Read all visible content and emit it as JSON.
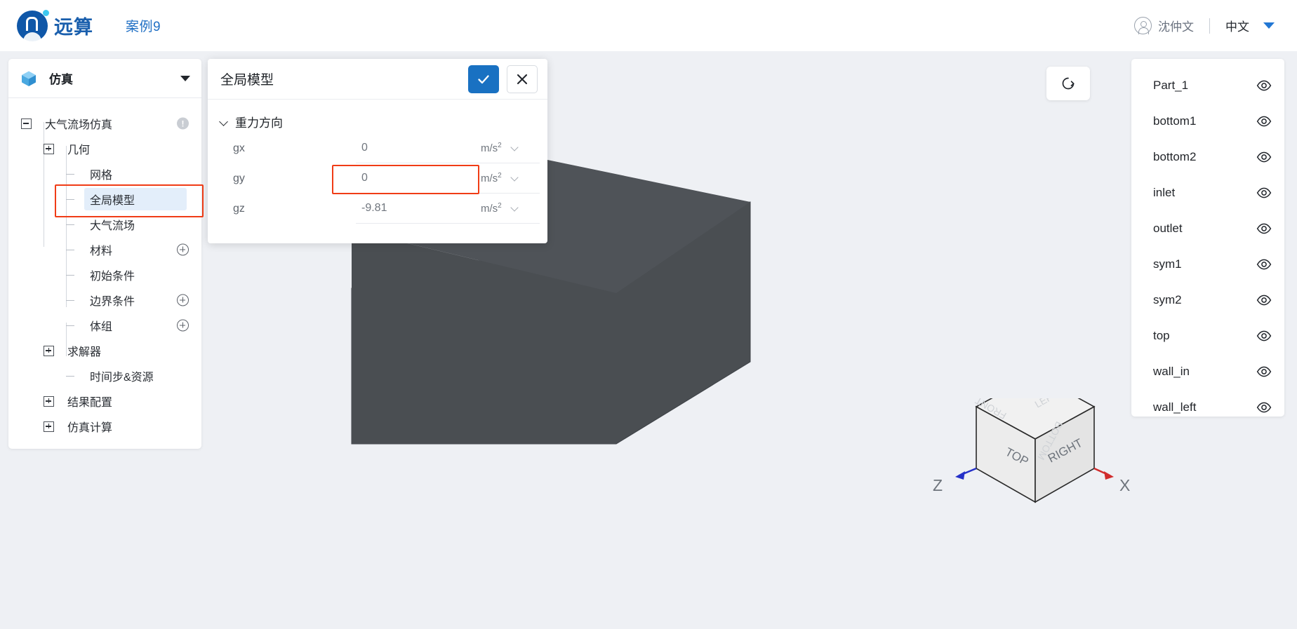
{
  "topbar": {
    "brand_name": "远算",
    "case_title": "案例9",
    "user_name": "沈仲文",
    "language": "中文"
  },
  "sidebar": {
    "header_title": "仿真",
    "tree": [
      {
        "label": "大气流场仿真",
        "toggle": "minus",
        "indent": 0,
        "badge": "!"
      },
      {
        "label": "几何",
        "toggle": "plus",
        "indent": 1
      },
      {
        "label": "网格",
        "toggle": "dash",
        "indent": 2
      },
      {
        "label": "全局模型",
        "toggle": "dash",
        "indent": 2,
        "selected": true
      },
      {
        "label": "大气流场",
        "toggle": "dash",
        "indent": 2
      },
      {
        "label": "材料",
        "toggle": "dash",
        "indent": 2,
        "add": true
      },
      {
        "label": "初始条件",
        "toggle": "dash",
        "indent": 2
      },
      {
        "label": "边界条件",
        "toggle": "dash",
        "indent": 2,
        "add": true
      },
      {
        "label": "体组",
        "toggle": "dash",
        "indent": 2,
        "add": true
      },
      {
        "label": "求解器",
        "toggle": "plus",
        "indent": 1
      },
      {
        "label": "时间步&资源",
        "toggle": "dash",
        "indent": 2
      },
      {
        "label": "结果配置",
        "toggle": "plus",
        "indent": 1
      },
      {
        "label": "仿真计算",
        "toggle": "plus",
        "indent": 1
      }
    ]
  },
  "dialog": {
    "title": "全局模型",
    "confirm_label": "✓",
    "cancel_label": "✕",
    "section_title": "重力方向",
    "fields": [
      {
        "label": "gx",
        "value": "0",
        "unit": "m/s",
        "unit_sup": "2"
      },
      {
        "label": "gy",
        "value": "0",
        "unit": "m/s",
        "unit_sup": "2"
      },
      {
        "label": "gz",
        "value": "-9.81",
        "unit": "m/s",
        "unit_sup": "2",
        "highlighted": true
      }
    ]
  },
  "parts_panel": {
    "items": [
      {
        "name": "Part_1"
      },
      {
        "name": "bottom1"
      },
      {
        "name": "bottom2"
      },
      {
        "name": "inlet"
      },
      {
        "name": "outlet"
      },
      {
        "name": "sym1"
      },
      {
        "name": "sym2"
      },
      {
        "name": "top"
      },
      {
        "name": "wall_in"
      },
      {
        "name": "wall_left"
      }
    ]
  },
  "viewport": {
    "reset_view_icon": "refresh-icon",
    "viewcube": {
      "face_top": "TOP",
      "face_right": "RIGHT",
      "face_back_left": "LEFT",
      "face_back_front": "FRONT",
      "face_back_bottom": "BOTTOM",
      "axis_z": "Z",
      "axis_x": "X"
    }
  },
  "colors": {
    "accent_blue": "#1971c2",
    "brand_blue": "#1a5fad",
    "highlight_red": "#f03c16",
    "selection_blue": "#e3eefa",
    "model_gray": "#4a4e52",
    "canvas_bg": "#eef0f4",
    "axis_x_red": "#d12c2c",
    "axis_z_blue": "#2430c8"
  }
}
